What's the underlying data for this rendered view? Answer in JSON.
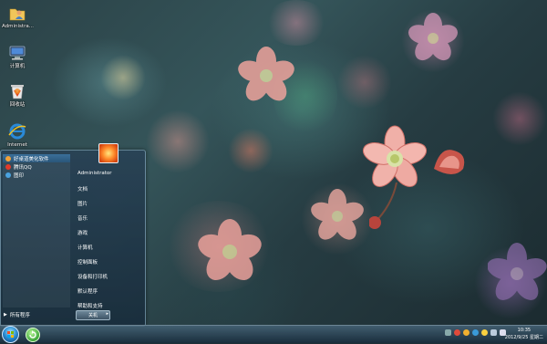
{
  "desktop": {
    "icons": [
      {
        "label": "Administra...",
        "icon": "user-folder-icon"
      },
      {
        "label": "计算机",
        "icon": "computer-icon"
      },
      {
        "label": "回收站",
        "icon": "recycle-bin-icon"
      },
      {
        "label": "Internet",
        "icon": "internet-explorer-icon"
      }
    ]
  },
  "start_menu": {
    "pinned": [
      {
        "label": "好桌道美化软件",
        "icon": "app-icon",
        "color": "#f2a23a"
      },
      {
        "label": "腾讯QQ",
        "icon": "qq-icon",
        "color": "#e23a2a"
      },
      {
        "label": "图印",
        "icon": "app-icon",
        "color": "#4aa3e0"
      }
    ],
    "all_programs": "所有程序",
    "right_items": [
      "Administrator",
      "文档",
      "图片",
      "音乐",
      "游戏",
      "计算机",
      "控制面板",
      "设备和打印机",
      "默认程序",
      "帮助和支持"
    ],
    "shutdown_label": "关机"
  },
  "taskbar": {
    "time": "10:35",
    "date": "2012/9/25 星期二"
  }
}
